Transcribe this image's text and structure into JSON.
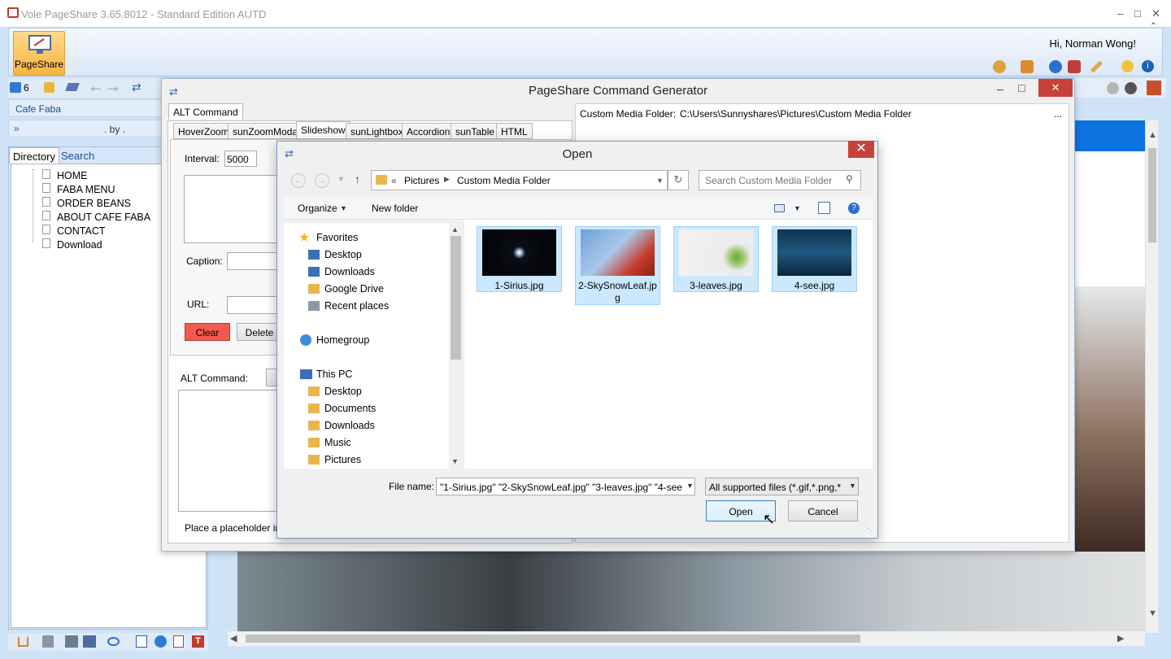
{
  "app": {
    "title": "Vole PageShare  3.65.8012 - Standard Edition AUTD",
    "pageshare_label": "PageShare",
    "greeting": "Hi, Norman Wong!",
    "nav_count": "6"
  },
  "sidebar": {
    "site": "Cafe Faba",
    "by": ". by .",
    "tabs": [
      "Directory",
      "Search"
    ],
    "items": [
      "HOME",
      "FABA MENU",
      "ORDER BEANS",
      "ABOUT CAFE FABA",
      "CONTACT",
      "Download"
    ]
  },
  "generator": {
    "title": "PageShare Command Generator",
    "main_tab": "ALT Command",
    "tabs": [
      "HoverZoom",
      "sunZoomModal",
      "Slideshow",
      "sunLightbox",
      "Accordion",
      "sunTable",
      "HTML"
    ],
    "interval_label": "Interval:",
    "interval_value": "5000",
    "caption_label": "Caption:",
    "url_label": "URL:",
    "clear_label": "Clear",
    "delete_label": "Delete",
    "alt_command_label": "ALT Command:",
    "placeholder_text": "Place a placeholder imag",
    "media_folder_label": "Custom Media Folder:",
    "media_folder_path": "C:\\Users\\Sunnyshares\\Pictures\\Custom Media Folder",
    "media_folder_more": "..."
  },
  "open_dialog": {
    "title": "Open",
    "breadcrumb": [
      "«",
      "Pictures",
      "Custom Media Folder"
    ],
    "search_placeholder": "Search Custom Media Folder",
    "organize_label": "Organize",
    "new_folder_label": "New folder",
    "nav": {
      "favorites": "Favorites",
      "favorites_items": [
        "Desktop",
        "Downloads",
        "Google Drive",
        "Recent places"
      ],
      "homegroup": "Homegroup",
      "this_pc": "This PC",
      "pc_items": [
        "Desktop",
        "Documents",
        "Downloads",
        "Music",
        "Pictures"
      ]
    },
    "files": [
      "1-Sirius.jpg",
      "2-SkySnowLeaf.jpg",
      "3-leaves.jpg",
      "4-see.jpg"
    ],
    "file_name_label": "File name:",
    "file_name_value": "\"1-Sirius.jpg\" \"2-SkySnowLeaf.jpg\" \"3-leaves.jpg\" \"4-see",
    "file_type_value": "All supported files (*.gif,*.png,*",
    "open_label": "Open",
    "cancel_label": "Cancel"
  },
  "colors": {
    "accent": "#0d73e0",
    "clear_button": "#f05a4f",
    "selection": "#cce8ff",
    "close_red": "#c7413a"
  }
}
